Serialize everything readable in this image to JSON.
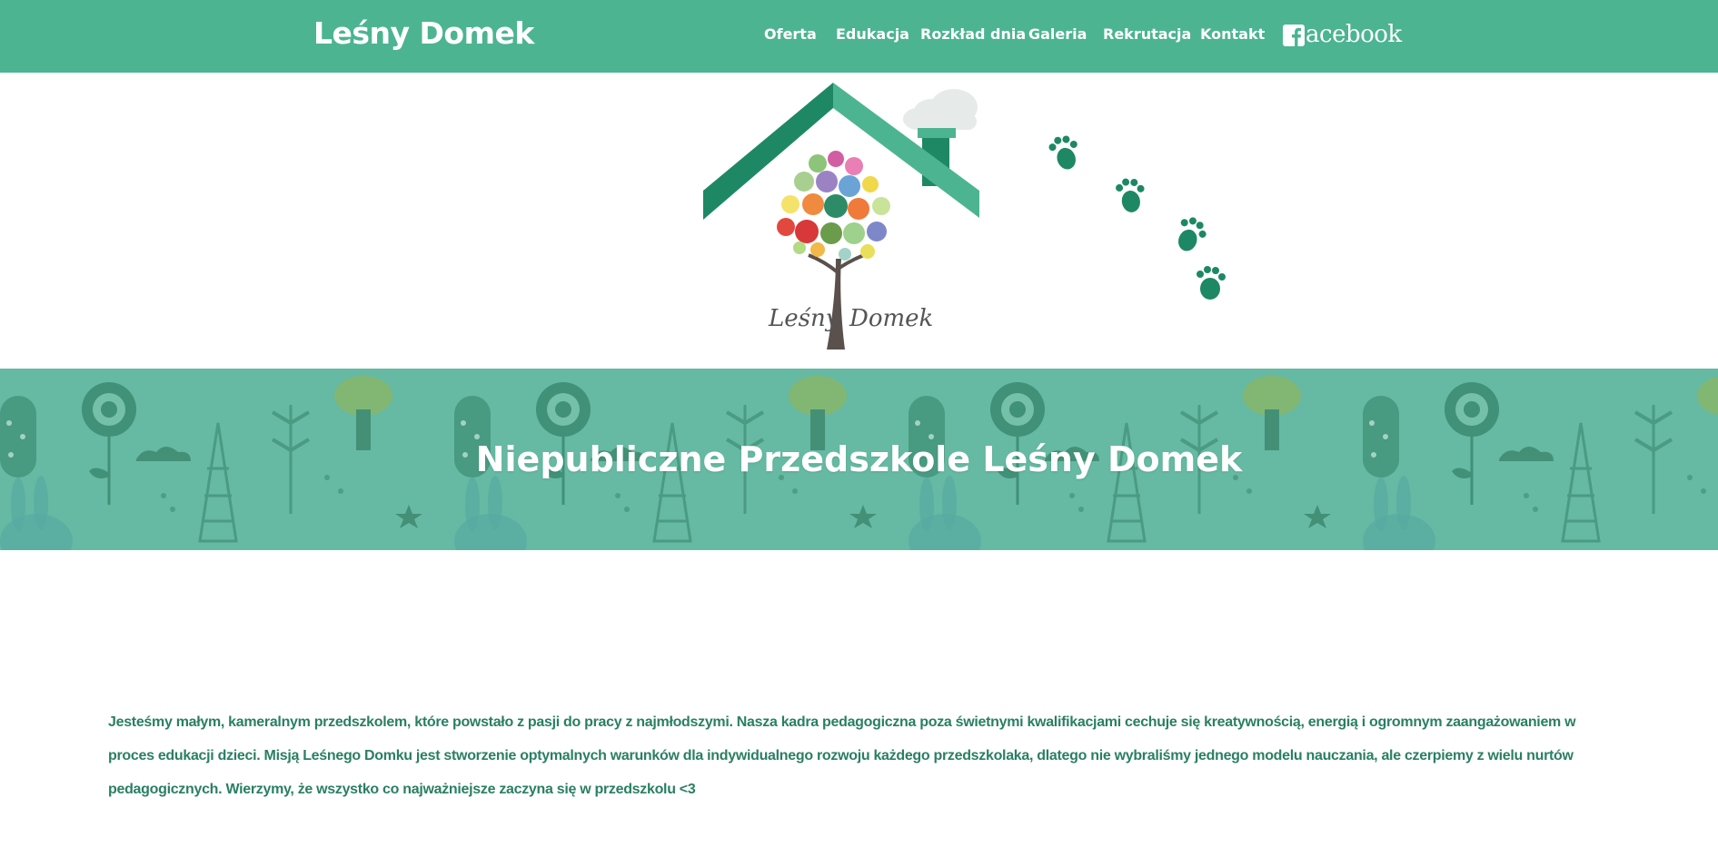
{
  "header": {
    "brand": "Leśny Domek",
    "nav": [
      {
        "label": "Oferta"
      },
      {
        "label": "Edukacja"
      },
      {
        "label": "Rozkład dnia"
      },
      {
        "label": "Galeria"
      },
      {
        "label": "Rekrutacja"
      },
      {
        "label": "Kontakt"
      }
    ],
    "facebook_label": "acebook",
    "facebook_icon": "facebook-f-icon"
  },
  "logo": {
    "text_left": "Leśny",
    "text_right": "Domek"
  },
  "hero": {
    "title": "Niepubliczne Przedszkole Leśny Domek"
  },
  "about": {
    "text": "Jesteśmy małym, kameralnym przedszkolem, które powstało z pasji do pracy z najmłodszymi. Nasza kadra pedagogiczna poza świetnymi kwalifikacjami cechuje się kreatywnością, energią i ogromnym zaangażowaniem w proces edukacji dzieci. Misją Leśnego Domku jest stworzenie optymalnych warunków dla indywidualnego rozwoju każdego przedszkolaka, dlatego nie wybraliśmy jednego modelu nauczania, ale czerpiemy z wielu nurtów pedagogicznych. Wierzymy, że wszystko co najważniejsze zaczyna się w przedszkolu <3"
  },
  "colors": {
    "nav_bg": "#4cb491",
    "hero_bg": "#64b8a2",
    "roof_dark": "#1e8864",
    "roof_light": "#4cb491",
    "text_green": "#2a7f63"
  }
}
